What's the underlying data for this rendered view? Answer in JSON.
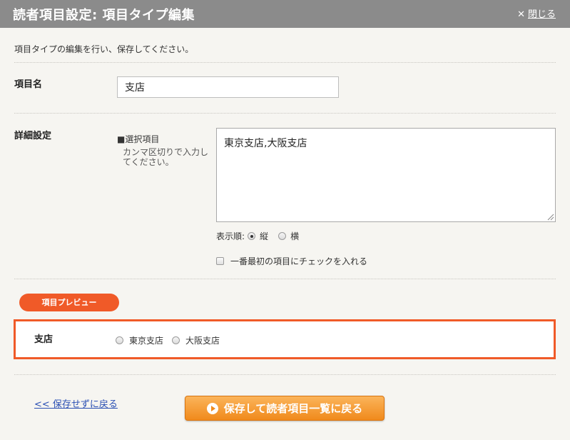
{
  "header": {
    "title": "読者項目設定: 項目タイプ編集",
    "close_label": "閉じる",
    "close_icon": "close-icon"
  },
  "description": "項目タイプの編集を行い、保存してください。",
  "fields": {
    "name_label": "項目名",
    "name_value": "支店",
    "detail_label": "詳細設定",
    "choices_label": "■選択項目",
    "choices_note": "カンマ区切りで入力してください。",
    "choices_value": "東京支店,大阪支店"
  },
  "display_order": {
    "label": "表示順:",
    "options": [
      "縦",
      "横"
    ],
    "selected": "縦"
  },
  "first_check": {
    "label": "一番最初の項目にチェックを入れる",
    "checked": false
  },
  "preview": {
    "badge": "項目プレビュー",
    "label": "支店",
    "options": [
      "東京支店",
      "大阪支店"
    ]
  },
  "actions": {
    "back_label": "<< 保存せずに戻る",
    "save_label": "保存して読者項目一覧に戻る"
  },
  "colors": {
    "accent": "#f05a28",
    "button": "#f08a1c",
    "header": "#8b8b8b",
    "link": "#2a4fb3"
  }
}
